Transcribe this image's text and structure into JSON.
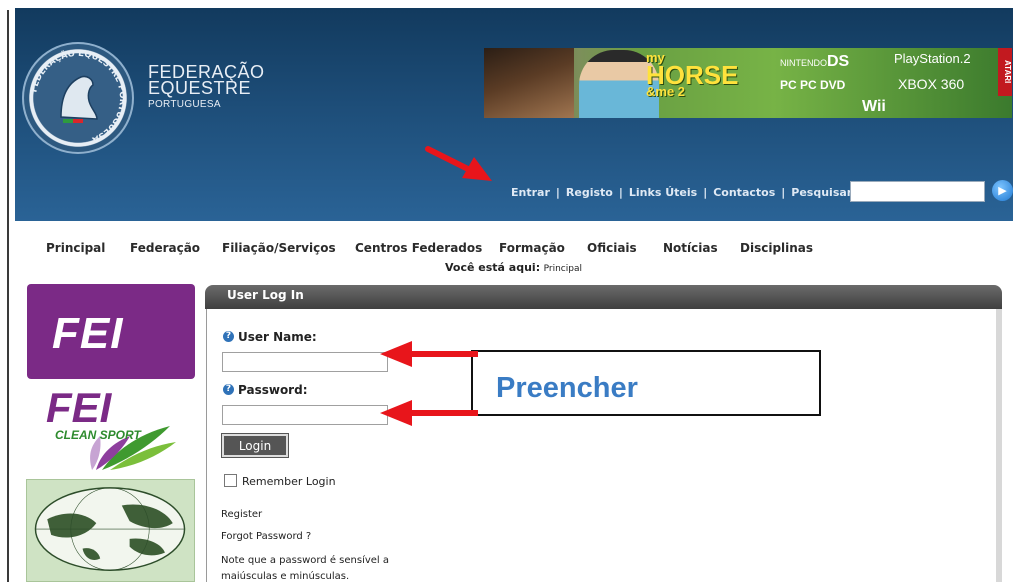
{
  "header": {
    "org_name": [
      "FEDERAÇÃO",
      "EQUESTRE",
      "PORTUGUESA"
    ],
    "seal_text": "FEDERAÇÃO EQUESTRE PORTUGUESA",
    "banner": {
      "game_title_small": "my",
      "game_title": "HORSE",
      "game_title_tail": "&me 2",
      "platform_ds_prefix": "NINTENDO",
      "platform_ds": "DS",
      "platform_ps2": "PlayStation.2",
      "platform_pc": "PC  PC DVD",
      "platform_xbox": "XBOX 360",
      "platform_wii": "Wii",
      "brand": "ATARI"
    },
    "top_links": [
      {
        "label": "Entrar"
      },
      {
        "label": "Registo"
      },
      {
        "label": "Links Úteis"
      },
      {
        "label": "Contactos"
      },
      {
        "label": "Pesquisar:"
      }
    ],
    "search": {
      "value": "",
      "placeholder": ""
    }
  },
  "nav": {
    "items": [
      "Principal",
      "Federação",
      "Filiação/Serviços",
      "Centros Federados",
      "Formação",
      "Oficiais",
      "Notícias",
      "Disciplinas"
    ],
    "breadcrumb_label": "Você está aqui:",
    "breadcrumb_current": "Principal"
  },
  "sponsors": {
    "fei": "FEI",
    "fei_clean": "FEI",
    "clean_sport": "CLEAN SPORT"
  },
  "login": {
    "title": "User Log In",
    "username_label": "User Name:",
    "username_value": "",
    "password_label": "Password:",
    "password_value": "",
    "login_button": "Login",
    "remember_label": "Remember Login",
    "remember_checked": false,
    "register_link": "Register",
    "forgot_link": "Forgot Password ?",
    "note": "Note que a password é sensível a maiúsculas e minúsculas."
  },
  "annotation": {
    "callout_text": "Preencher",
    "arrow_color": "#e8151b"
  },
  "colors": {
    "header_dark": "#123a5e",
    "header_light": "#2a6396",
    "fei_purple": "#7b2a86",
    "callout_blue": "#3a7cc4"
  }
}
